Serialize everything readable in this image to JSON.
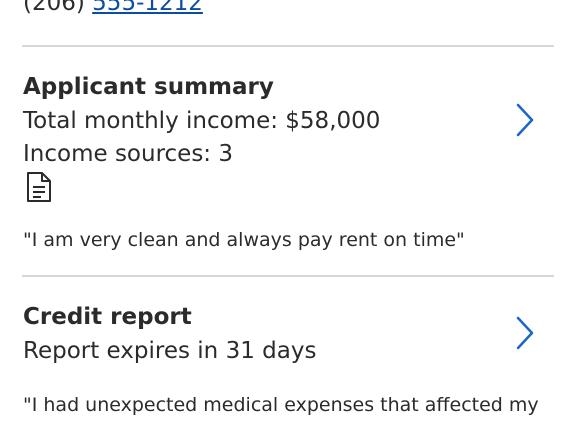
{
  "contact": {
    "phone_prefix": "(206) ",
    "phone_link": "555-1212"
  },
  "applicant_summary": {
    "title": "Applicant summary",
    "income": "Total monthly income: $58,000",
    "sources": "Income sources: 3",
    "document_icon": "document-icon",
    "quote": "\"I am very clean and always pay rent on time\"",
    "chevron_icon": "chevron-right-icon"
  },
  "credit_report": {
    "title": "Credit report",
    "expiry": "Report expires in 31 days",
    "quote": "\"I had unexpected medical expenses that affected my",
    "chevron_icon": "chevron-right-icon"
  },
  "colors": {
    "text": "#2b2b2b",
    "link": "#0d4da1",
    "chevron": "#1a66c8",
    "divider": "#d6d6d6"
  }
}
